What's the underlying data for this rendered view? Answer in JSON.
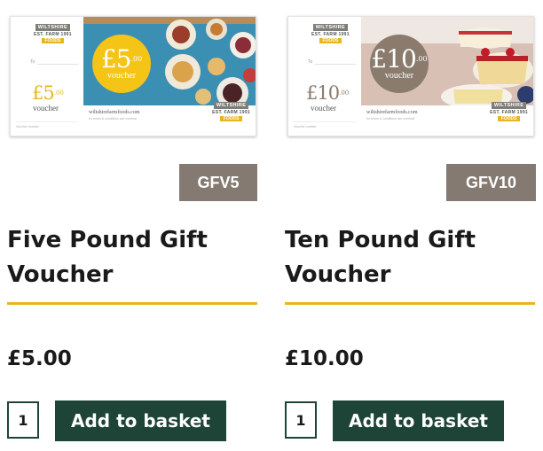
{
  "products": [
    {
      "title": "Five Pound Gift Voucher",
      "sku": "GFV5",
      "price": "£5.00",
      "quantity": "1",
      "add_button": "Add to basket",
      "voucher": {
        "logo_line1": "WILTSHIRE",
        "logo_line2": "EST. FARM 1991",
        "logo_line3": "FOODS",
        "to_label": "To",
        "amount": "£5",
        "amount_pence": ".00",
        "word": "voucher",
        "website": "wiltshirefarmfoods.com",
        "tagline": "for terms & conditions see overleaf",
        "small_text": "Voucher number",
        "circle_color": "#f4c416",
        "amount_color": "#e9b51f",
        "photo_bg": "#3a8fb2"
      }
    },
    {
      "title": "Ten Pound Gift Voucher",
      "sku": "GFV10",
      "price": "£10.00",
      "quantity": "1",
      "add_button": "Add to basket",
      "voucher": {
        "logo_line1": "WILTSHIRE",
        "logo_line2": "EST. FARM 1991",
        "logo_line3": "FOODS",
        "to_label": "To",
        "amount": "£10",
        "amount_pence": ".00",
        "word": "voucher",
        "website": "wiltshirefarmfoods.com",
        "tagline": "for terms & conditions see overleaf",
        "small_text": "Voucher number",
        "circle_color": "#8a7b6d",
        "amount_color": "#8a7b6d",
        "photo_bg": "#d9b6a6"
      }
    }
  ],
  "colors": {
    "accent": "#e9b51f",
    "button": "#1e4337",
    "sku_badge": "#857a71",
    "text": "#1a1a1a"
  }
}
